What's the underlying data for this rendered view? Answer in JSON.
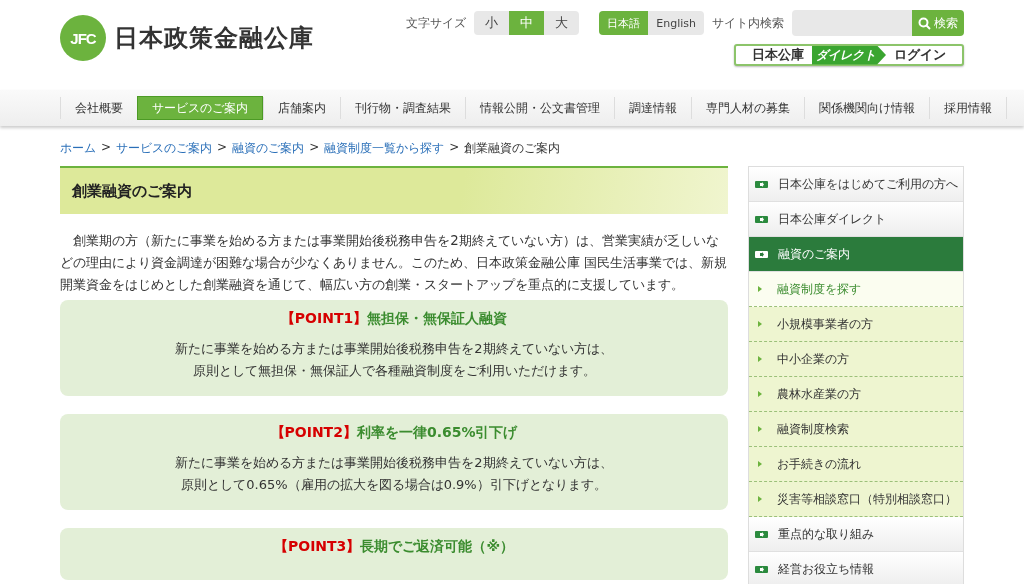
{
  "logo": {
    "mark": "JFC",
    "name": "日本政策金融公庫"
  },
  "font_size": {
    "label": "文字サイズ",
    "options": [
      {
        "label": "小",
        "selected": false
      },
      {
        "label": "中",
        "selected": true
      },
      {
        "label": "大",
        "selected": false
      }
    ]
  },
  "languages": [
    {
      "label": "日本語",
      "selected": true
    },
    {
      "label": "English",
      "selected": false
    }
  ],
  "search": {
    "label": "サイト内検索",
    "button": "検索"
  },
  "login": {
    "brand": "日本公庫",
    "badge": "ダイレクト",
    "label": "ログイン"
  },
  "nav": [
    {
      "label": "会社概要",
      "selected": false
    },
    {
      "label": "サービスのご案内",
      "selected": true
    },
    {
      "label": "店舗案内",
      "selected": false
    },
    {
      "label": "刊行物・調査結果",
      "selected": false
    },
    {
      "label": "情報公開・公文書管理",
      "selected": false
    },
    {
      "label": "調達情報",
      "selected": false
    },
    {
      "label": "専門人材の募集",
      "selected": false
    },
    {
      "label": "関係機関向け情報",
      "selected": false
    },
    {
      "label": "採用情報",
      "selected": false
    }
  ],
  "breadcrumbs": [
    {
      "label": "ホーム",
      "link": true
    },
    {
      "label": "サービスのご案内",
      "link": true
    },
    {
      "label": "融資のご案内",
      "link": true
    },
    {
      "label": "融資制度一覧から探す",
      "link": true
    },
    {
      "label": "創業融資のご案内",
      "link": false
    }
  ],
  "breadcrumb_separator": ">",
  "page_title": "創業融資のご案内",
  "intro": "創業期の方（新たに事業を始める方または事業開始後税務申告を2期終えていない方）は、営業実績が乏しいなどの理由により資金調達が困難な場合が少なくありません。このため、日本政策金融公庫 国民生活事業では、新規開業資金をはじめとした創業融資を通じて、幅広い方の創業・スタートアップを重点的に支援しています。",
  "points": [
    {
      "label": "【POINT1】",
      "title": "無担保・無保証人融資",
      "lines": [
        "新たに事業を始める方または事業開始後税務申告を2期終えていない方は、",
        "原則として無担保・無保証人で各種融資制度をご利用いただけます。"
      ]
    },
    {
      "label": "【POINT2】",
      "title": "利率を一律0.65%引下げ",
      "lines": [
        "新たに事業を始める方または事業開始後税務申告を2期終えていない方は、",
        "原則として0.65%（雇用の拡大を図る場合は0.9%）引下げとなります。"
      ]
    },
    {
      "label": "【POINT3】",
      "title": "長期でご返済可能（※）"
    }
  ],
  "sidebar": [
    {
      "kind": "main",
      "label": "日本公庫をはじめてご利用の方へ",
      "selected": false
    },
    {
      "kind": "main",
      "label": "日本公庫ダイレクト",
      "selected": false
    },
    {
      "kind": "main",
      "label": "融資のご案内",
      "selected": true
    },
    {
      "kind": "sub",
      "label": "融資制度を探す",
      "selected": true
    },
    {
      "kind": "sub",
      "label": "小規模事業者の方",
      "selected": false
    },
    {
      "kind": "sub",
      "label": "中小企業の方",
      "selected": false
    },
    {
      "kind": "sub",
      "label": "農林水産業の方",
      "selected": false
    },
    {
      "kind": "sub",
      "label": "融資制度検索",
      "selected": false
    },
    {
      "kind": "sub",
      "label": "お手続きの流れ",
      "selected": false
    },
    {
      "kind": "sub",
      "label": "災害等相談窓口（特別相談窓口）",
      "selected": false
    },
    {
      "kind": "main",
      "label": "重点的な取り組み",
      "selected": false
    },
    {
      "kind": "main",
      "label": "経営お役立ち情報",
      "selected": false
    }
  ]
}
